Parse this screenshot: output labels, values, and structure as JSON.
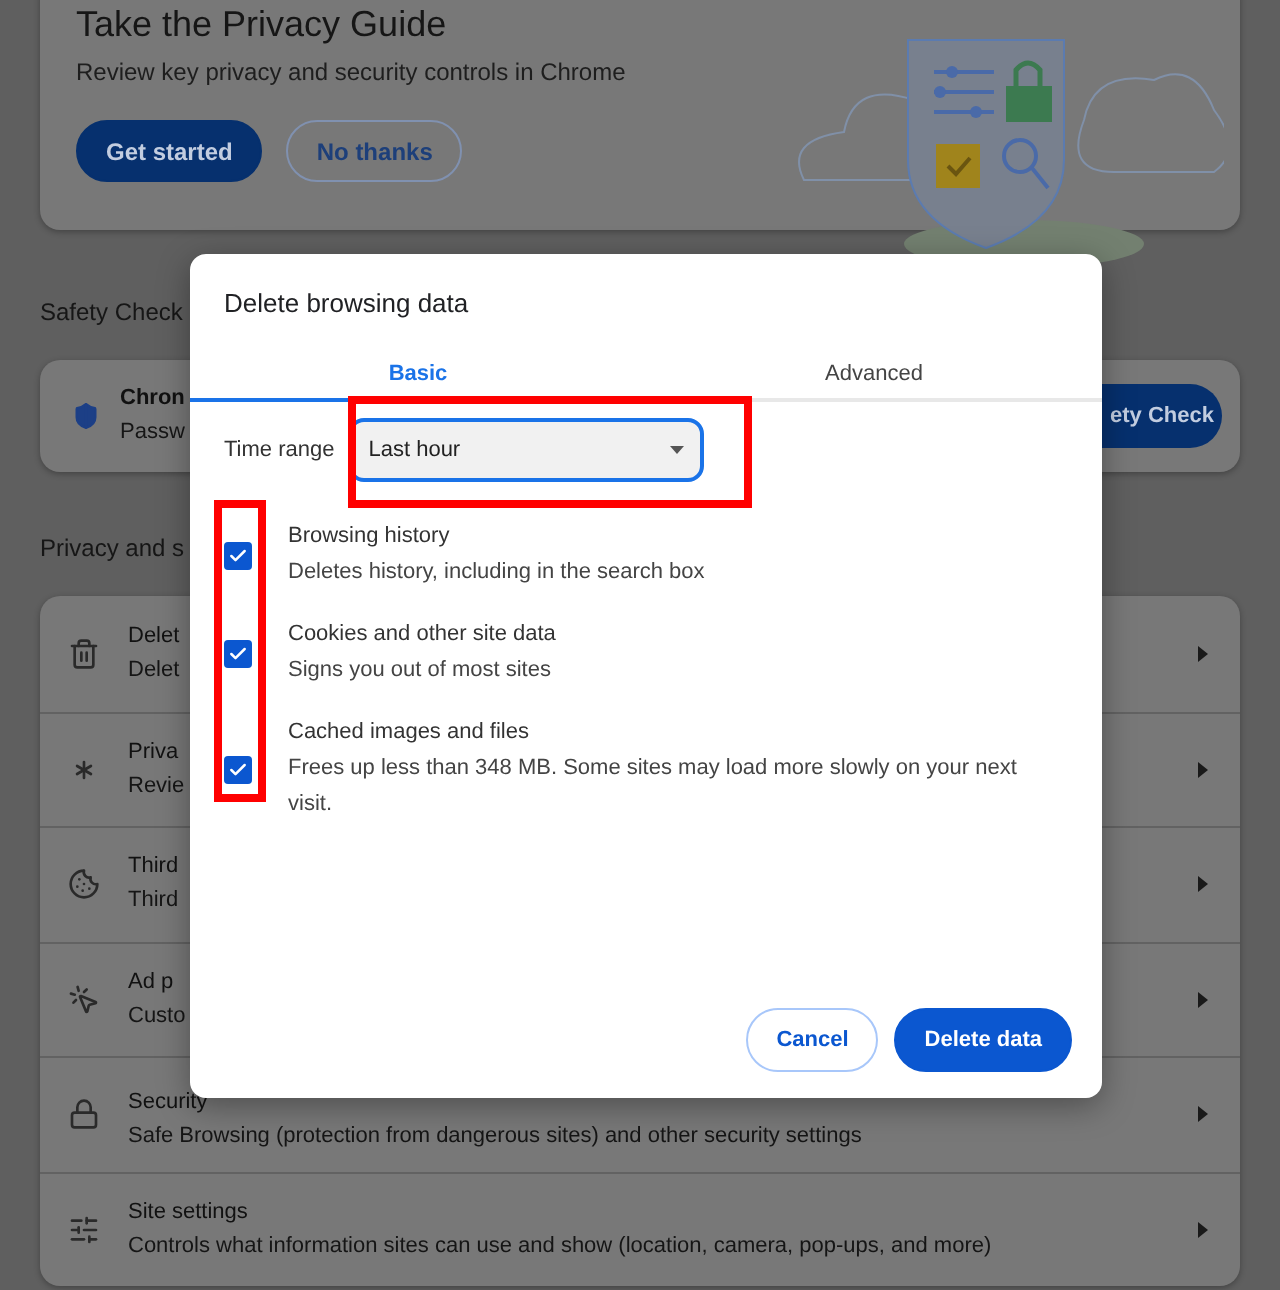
{
  "privacy_guide": {
    "title": "Take the Privacy Guide",
    "description": "Review key privacy and security controls in Chrome",
    "buttons": [
      {
        "label": "Get started",
        "kind": "primary"
      },
      {
        "label": "No thanks",
        "kind": "outline"
      }
    ]
  },
  "safety_check": {
    "heading": "Safety Check",
    "title": "Chron",
    "subtitle": "Passw",
    "button": "ety Check"
  },
  "privacy_section": {
    "heading": "Privacy and s",
    "rows": [
      {
        "title": "Delet",
        "subtitle": "Delet"
      },
      {
        "title": "Priva",
        "subtitle": "Revie"
      },
      {
        "title": "Third",
        "subtitle": "Third"
      },
      {
        "title": "Ad p",
        "subtitle": "Custo"
      },
      {
        "title": "Security",
        "subtitle": "Safe Browsing (protection from dangerous sites) and other security settings"
      },
      {
        "title": "Site settings",
        "subtitle": "Controls what information sites can use and show (location, camera, pop-ups, and more)"
      }
    ]
  },
  "dialog": {
    "title": "Delete browsing data",
    "tabs": [
      {
        "label": "Basic",
        "selected": true
      },
      {
        "label": "Advanced",
        "selected": false
      }
    ],
    "time_range": {
      "label": "Time range",
      "value": "Last hour",
      "highlighted": true
    },
    "checkboxes_highlighted": true,
    "items": [
      {
        "title": "Browsing history",
        "description": "Deletes history, including in the search box",
        "checked": true
      },
      {
        "title": "Cookies and other site data",
        "description": "Signs you out of most sites",
        "checked": true
      },
      {
        "title": "Cached images and files",
        "description": "Frees up less than 348 MB. Some sites may load more slowly on your next visit.",
        "checked": true
      }
    ],
    "buttons": [
      {
        "label": "Cancel",
        "kind": "outline"
      },
      {
        "label": "Delete data",
        "kind": "primary"
      }
    ]
  }
}
